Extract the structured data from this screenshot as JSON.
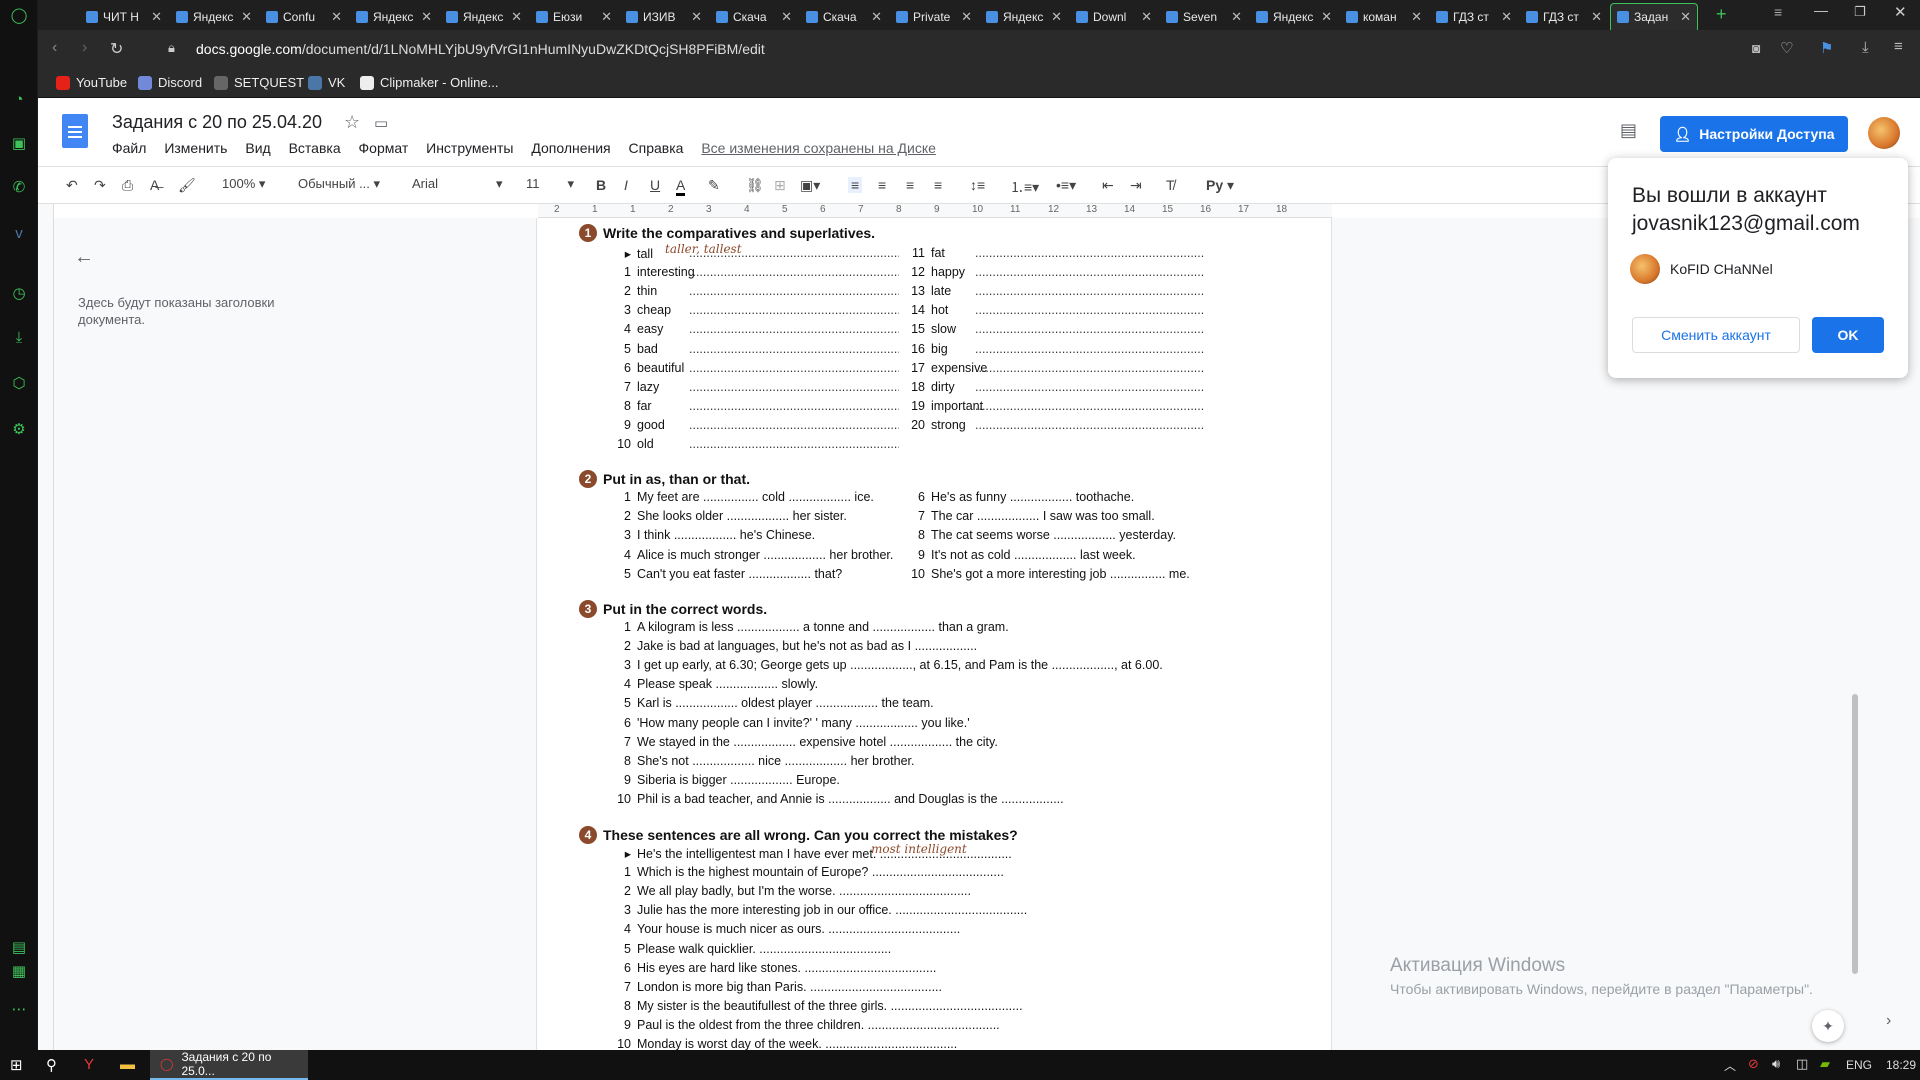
{
  "browser": {
    "tabs": [
      {
        "title": "ЧИТ Н"
      },
      {
        "title": "Яндекс"
      },
      {
        "title": "Confu"
      },
      {
        "title": "Яндекс"
      },
      {
        "title": "Яндекс"
      },
      {
        "title": "Еюзи"
      },
      {
        "title": "ИЗИВ"
      },
      {
        "title": "Скача"
      },
      {
        "title": "Скача"
      },
      {
        "title": "Private"
      },
      {
        "title": "Яндекс"
      },
      {
        "title": "Downl"
      },
      {
        "title": "Seven"
      },
      {
        "title": "Яндекс"
      },
      {
        "title": "коман"
      },
      {
        "title": "ГДЗ ст"
      },
      {
        "title": "ГДЗ ст"
      },
      {
        "title": "Задан",
        "active": true
      }
    ],
    "url_domain": "docs.google.com",
    "url_path": "/document/d/1LNoMHLYjbU9yfVrGI1nHumINyuDwZKDtQcjSH8PFiBM/edit",
    "bookmarks": [
      "YouTube",
      "Discord",
      "SETQUEST",
      "VK",
      "Clipmaker - Online..."
    ],
    "accent": "#3ec35a"
  },
  "docs": {
    "title": "Задания с 20 по 25.04.20",
    "menus": [
      "Файл",
      "Изменить",
      "Вид",
      "Вставка",
      "Формат",
      "Инструменты",
      "Дополнения",
      "Справка"
    ],
    "saved_status": "Все изменения сохранены на Диске",
    "share_label": "Настройки Доступа",
    "accent": "#1a73e8",
    "toolbar": {
      "zoom": "100%",
      "style": "Обычный ...",
      "font": "Arial",
      "size": "11"
    },
    "outline_hint": "Здесь будут показаны заголовки документа.",
    "ruler_labels": [
      "2",
      "1",
      "1",
      "2",
      "3",
      "4",
      "5",
      "6",
      "7",
      "8",
      "9",
      "10",
      "11",
      "12",
      "13",
      "14",
      "15",
      "16",
      "17",
      "18"
    ]
  },
  "document": {
    "ex1": {
      "num": "1",
      "heading": "Write the comparatives and superlatives.",
      "example_answer": "taller, tallest",
      "left": [
        {
          "n": "▸",
          "word": "tall"
        },
        {
          "n": "1",
          "word": "interesting"
        },
        {
          "n": "2",
          "word": "thin"
        },
        {
          "n": "3",
          "word": "cheap"
        },
        {
          "n": "4",
          "word": "easy"
        },
        {
          "n": "5",
          "word": "bad"
        },
        {
          "n": "6",
          "word": "beautiful"
        },
        {
          "n": "7",
          "word": "lazy"
        },
        {
          "n": "8",
          "word": "far"
        },
        {
          "n": "9",
          "word": "good"
        },
        {
          "n": "10",
          "word": "old"
        }
      ],
      "right": [
        {
          "n": "11",
          "word": "fat"
        },
        {
          "n": "12",
          "word": "happy"
        },
        {
          "n": "13",
          "word": "late"
        },
        {
          "n": "14",
          "word": "hot"
        },
        {
          "n": "15",
          "word": "slow"
        },
        {
          "n": "16",
          "word": "big"
        },
        {
          "n": "17",
          "word": "expensive"
        },
        {
          "n": "18",
          "word": "dirty"
        },
        {
          "n": "19",
          "word": "important"
        },
        {
          "n": "20",
          "word": "strong"
        }
      ]
    },
    "ex2": {
      "num": "2",
      "heading": "Put in as, than or that.",
      "left": [
        {
          "n": "1",
          "text": "My feet are ................ cold .................. ice."
        },
        {
          "n": "2",
          "text": "She looks older .................. her sister."
        },
        {
          "n": "3",
          "text": "I think .................. he's Chinese."
        },
        {
          "n": "4",
          "text": "Alice is much stronger .................. her brother."
        },
        {
          "n": "5",
          "text": "Can't you eat faster .................. that?"
        }
      ],
      "right": [
        {
          "n": "6",
          "text": "He's as funny .................. toothache."
        },
        {
          "n": "7",
          "text": "The car .................. I saw was too small."
        },
        {
          "n": "8",
          "text": "The cat seems worse .................. yesterday."
        },
        {
          "n": "9",
          "text": "It's not as cold .................. last week."
        },
        {
          "n": "10",
          "text": "She's got a more interesting job ................ me."
        }
      ]
    },
    "ex3": {
      "num": "3",
      "heading": "Put in the correct words.",
      "rows": [
        {
          "n": "1",
          "text": "A kilogram is less .................. a tonne and .................. than a gram."
        },
        {
          "n": "2",
          "text": "Jake is bad at languages, but he's not as bad as I .................."
        },
        {
          "n": "3",
          "text": "I get up early, at 6.30; George gets up .................., at 6.15, and Pam is the .................., at 6.00."
        },
        {
          "n": "4",
          "text": "Please speak .................. slowly."
        },
        {
          "n": "5",
          "text": "Karl is .................. oldest player .................. the team."
        },
        {
          "n": "6",
          "text": "'How many people can I invite?' '                    many .................. you like.'"
        },
        {
          "n": "7",
          "text": "We stayed in the .................. expensive hotel .................. the city."
        },
        {
          "n": "8",
          "text": "She's not .................. nice .................. her brother."
        },
        {
          "n": "9",
          "text": "Siberia is bigger .................. Europe."
        },
        {
          "n": "10",
          "text": "Phil is a bad teacher, and Annie is .................. and Douglas is the .................."
        }
      ]
    },
    "ex4": {
      "num": "4",
      "heading": "These sentences are all wrong. Can you correct the mistakes?",
      "example_answer": "most intelligent",
      "rows": [
        {
          "n": "▸",
          "text": "He's the intelligentest man I have ever met.   ......................................"
        },
        {
          "n": "1",
          "text": "Which is the highest mountain of Europe?   ......................................"
        },
        {
          "n": "2",
          "text": "We all play badly, but I'm the worse.   ......................................"
        },
        {
          "n": "3",
          "text": "Julie has the more interesting job in our office.   ......................................"
        },
        {
          "n": "4",
          "text": "Your house is much nicer as ours.   ......................................"
        },
        {
          "n": "5",
          "text": "Please walk quicklier.   ......................................"
        },
        {
          "n": "6",
          "text": "His eyes are hard like stones.   ......................................"
        },
        {
          "n": "7",
          "text": "London is more big than Paris.   ......................................"
        },
        {
          "n": "8",
          "text": "My sister is the beautifullest of the three girls.   ......................................"
        },
        {
          "n": "9",
          "text": "Paul is the oldest from the three children.   ......................................"
        },
        {
          "n": "10",
          "text": "Monday is worst day of the week.   ......................................"
        }
      ]
    }
  },
  "popup": {
    "heading": "Вы вошли в аккаунт",
    "email": "jovasnik123@gmail.com",
    "account_name": "KoFID CHaNNel",
    "switch_label": "Сменить аккаунт",
    "ok_label": "OK"
  },
  "activation": {
    "title": "Активация Windows",
    "subtitle": "Чтобы активировать Windows, перейдите в раздел \"Параметры\"."
  },
  "taskbar": {
    "task_title": "Задания с 20 по 25.0...",
    "lang": "ENG",
    "time": "18:29"
  }
}
